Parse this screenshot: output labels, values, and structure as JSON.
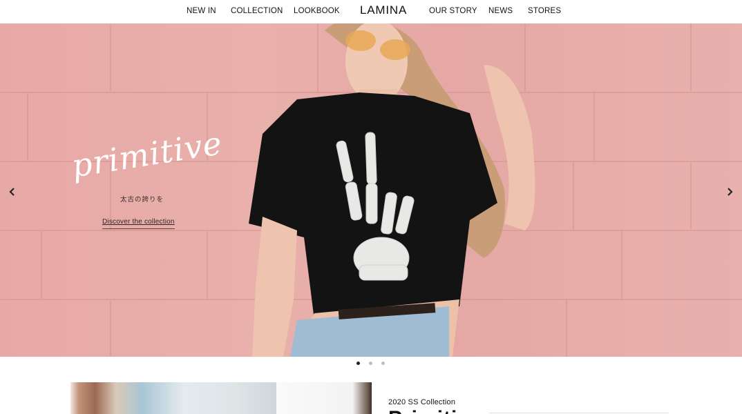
{
  "nav": {
    "items": [
      "NEW IN",
      "COLLECTION",
      "LOOKBOOK",
      "OUR STORY",
      "NEWS",
      "STORES"
    ],
    "brand": "LAMINA"
  },
  "hero": {
    "script_title": "primitive",
    "subtitle_jp": "太古の誇りを",
    "cta": "Discover the collection",
    "prev_icon": "chevron-left-icon",
    "next_icon": "chevron-right-icon",
    "slides": {
      "count": 3,
      "active": 1
    }
  },
  "section": {
    "collection_label": "2020 SS Collection",
    "collection_title": "Primitive"
  },
  "colors": {
    "hero_bg": "#e7a9a5",
    "text": "#111111",
    "dot_active": "#222222",
    "dot_inactive": "#bdbdbd"
  }
}
